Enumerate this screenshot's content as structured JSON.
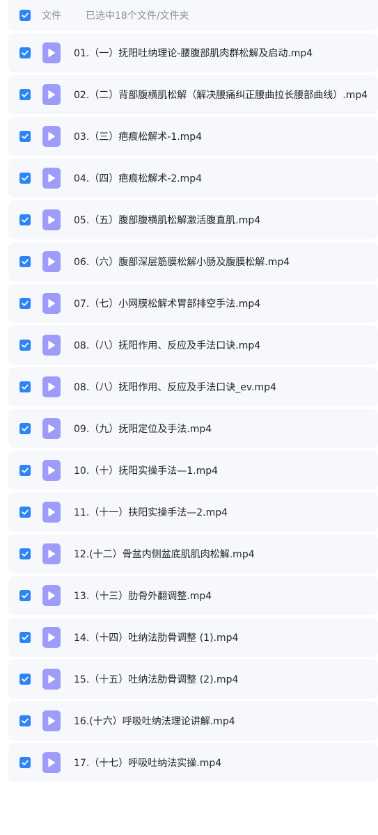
{
  "header": {
    "label": "文件",
    "selection_status": "已选中18个文件/文件夹",
    "checked": true
  },
  "colors": {
    "checkbox": "#2b85f5",
    "video_icon": "#9d9cf8",
    "row_background": "#f7f8fb"
  },
  "files": [
    {
      "name": "01.（一）抚阳吐纳理论-腰腹部肌肉群松解及启动.mp4",
      "icon": "video-file-icon",
      "checked": true
    },
    {
      "name": "02.（二）背部腹横肌松解（解决腰痛纠正腰曲拉长腰部曲线）.mp4",
      "icon": "video-file-icon",
      "checked": true
    },
    {
      "name": "03.（三）疤痕松解术-1.mp4",
      "icon": "video-file-icon",
      "checked": true
    },
    {
      "name": "04.（四）疤痕松解术-2.mp4",
      "icon": "video-file-icon",
      "checked": true
    },
    {
      "name": "05.（五）腹部腹横肌松解激活腹直肌.mp4",
      "icon": "video-file-icon",
      "checked": true
    },
    {
      "name": "06.（六）腹部深层筋膜松解小肠及腹膜松解.mp4",
      "icon": "video-file-icon",
      "checked": true
    },
    {
      "name": "07.（七）小网膜松解术胃部排空手法.mp4",
      "icon": "video-file-icon",
      "checked": true
    },
    {
      "name": "08.（八）抚阳作用、反应及手法口诀.mp4",
      "icon": "video-file-icon",
      "checked": true
    },
    {
      "name": "08.（八）抚阳作用、反应及手法口诀_ev.mp4",
      "icon": "video-file-icon",
      "checked": true
    },
    {
      "name": "09.（九）抚阳定位及手法.mp4",
      "icon": "video-file-icon",
      "checked": true
    },
    {
      "name": "10.（十）抚阳实操手法—1.mp4",
      "icon": "video-file-icon",
      "checked": true
    },
    {
      "name": "11.（十一）扶阳实操手法—2.mp4",
      "icon": "video-file-icon",
      "checked": true
    },
    {
      "name": "12.(十二）骨盆内侧盆底肌肌肉松解.mp4",
      "icon": "video-file-icon",
      "checked": true
    },
    {
      "name": "13.（十三）肋骨外翻调整.mp4",
      "icon": "video-file-icon",
      "checked": true
    },
    {
      "name": "14.（十四）吐纳法肋骨调整 (1).mp4",
      "icon": "video-file-icon",
      "checked": true
    },
    {
      "name": "15.（十五）吐纳法肋骨调整 (2).mp4",
      "icon": "video-file-icon",
      "checked": true
    },
    {
      "name": "16.(十六）呼吸吐纳法理论讲解.mp4",
      "icon": "video-file-icon",
      "checked": true
    },
    {
      "name": "17.（十七）呼吸吐纳法实操.mp4",
      "icon": "video-file-icon",
      "checked": true
    }
  ]
}
